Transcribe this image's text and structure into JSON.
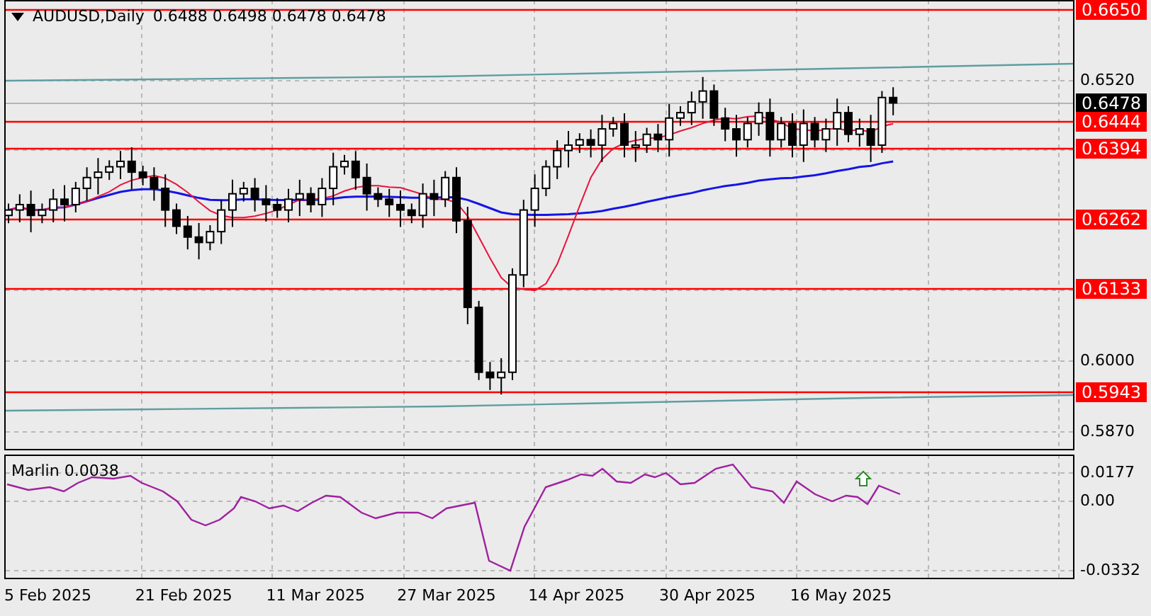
{
  "chart": {
    "symbol": "AUDUSD,Daily",
    "ohlc": "0.6488 0.6498 0.6478 0.6478",
    "price_ticks": [
      "0.6520",
      "0.6000",
      "0.5870"
    ],
    "levels": [
      {
        "label": "0.6650"
      },
      {
        "label": "0.6444"
      },
      {
        "label": "0.6394"
      },
      {
        "label": "0.6262"
      },
      {
        "label": "0.6133"
      },
      {
        "label": "0.5943"
      }
    ],
    "current_price": "0.6478"
  },
  "indicator": {
    "title": "Marlin 0.0038",
    "ticks": [
      "0.0177",
      "0.00",
      "-0.0332"
    ]
  },
  "dates": [
    "5 Feb 2025",
    "21 Feb 2025",
    "11 Mar 2025",
    "27 Mar 2025",
    "14 Apr 2025",
    "30 Apr 2025",
    "16 May 2025"
  ]
}
